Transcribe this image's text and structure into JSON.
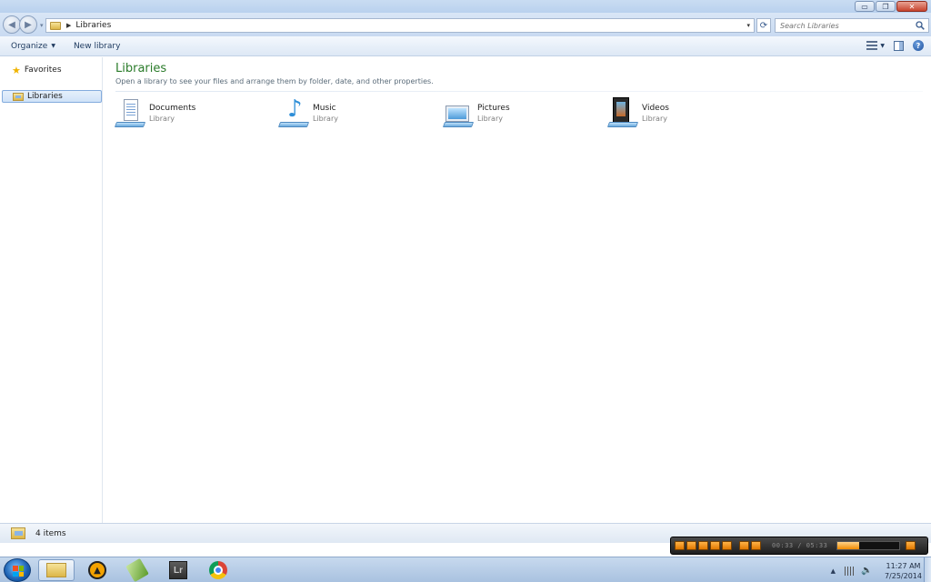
{
  "window": {
    "controls": {
      "minimize": "▭",
      "maximize": "❐",
      "close": "✕"
    }
  },
  "navigation": {
    "back": "◀",
    "forward": "▶",
    "address_path": "Libraries",
    "refresh": "⟳",
    "search_placeholder": "Search Libraries"
  },
  "toolbar": {
    "organize": "Organize",
    "new_library": "New library"
  },
  "nav_pane": {
    "items": [
      {
        "label": "Favorites",
        "icon": "star-icon"
      },
      {
        "label": "Libraries",
        "icon": "libraries-icon",
        "selected": true
      }
    ]
  },
  "content": {
    "title": "Libraries",
    "description": "Open a library to see your files and arrange them by folder, date, and other properties.",
    "libraries": [
      {
        "name": "Documents",
        "type": "Library",
        "icon": "documents-library-icon"
      },
      {
        "name": "Music",
        "type": "Library",
        "icon": "music-library-icon"
      },
      {
        "name": "Pictures",
        "type": "Library",
        "icon": "pictures-library-icon"
      },
      {
        "name": "Videos",
        "type": "Library",
        "icon": "videos-library-icon"
      }
    ]
  },
  "status": {
    "item_count": "4 items"
  },
  "player": {
    "time": "00:33 / 05:33",
    "volume": 0.35
  },
  "taskbar": {
    "apps": [
      "windows-explorer",
      "aimp",
      "editor",
      "lightroom",
      "chrome"
    ],
    "lightroom_label": "Lr",
    "clock_time": "11:27 AM",
    "clock_date": "7/25/2014"
  },
  "colors": {
    "title_green": "#2a7b2a",
    "selection_blue": "#cfe2f8",
    "player_orange": "#f08a00"
  }
}
